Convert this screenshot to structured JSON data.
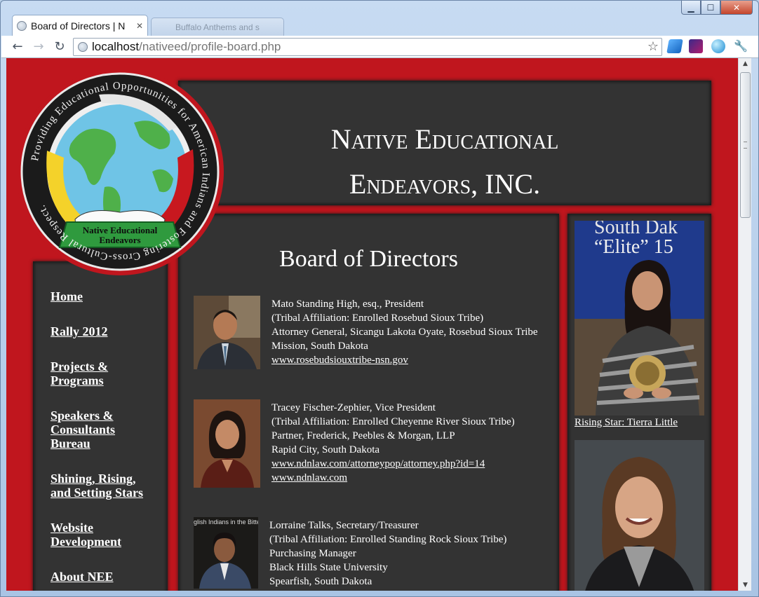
{
  "browser": {
    "active_tab_title": "Board of Directors | N",
    "background_tab_title": "Buffalo Anthems and s",
    "url_host": "localhost",
    "url_path": "/nativeed/profile-board.php",
    "window_controls": [
      "minimize",
      "maximize",
      "close"
    ]
  },
  "logo": {
    "ring_text": "Providing Educational Opportunities for American Indians and Fostering Cross-Cultural Respect.",
    "banner_line1": "Native Educational",
    "banner_line2": "Endeavors"
  },
  "header": {
    "title": "Native Educational Endeavors, INC."
  },
  "nav": {
    "items": [
      {
        "label": "Home"
      },
      {
        "label": "Rally 2012"
      },
      {
        "label": "Projects & Programs"
      },
      {
        "label": "Speakers & Consultants Bureau"
      },
      {
        "label": "Shining, Rising, and Setting Stars"
      },
      {
        "label": "Website Development"
      },
      {
        "label": "About NEE"
      }
    ]
  },
  "main": {
    "heading": "Board of Directors",
    "members": [
      {
        "lines": [
          "Mato Standing High, esq., President",
          "(Tribal Affiliation: Enrolled Rosebud Sioux Tribe)",
          "Attorney General, Sicangu Lakota Oyate, Rosebud Sioux Tribe",
          "Mission, South Dakota"
        ],
        "links": [
          "www.rosebudsiouxtribe-nsn.gov"
        ]
      },
      {
        "lines": [
          "Tracey Fischer-Zephier, Vice President",
          "(Tribal Affiliation: Enrolled Cheyenne River Sioux Tribe)",
          "Partner, Frederick, Peebles & Morgan, LLP",
          "Rapid City, South Dakota"
        ],
        "links": [
          "www.ndnlaw.com/attorneypop/attorney.php?id=14",
          "www.ndnlaw.com"
        ]
      },
      {
        "lines": [
          "Lorraine Talks, Secretary/Treasurer",
          "(Tribal Affiliation: Enrolled Standing Rock Sioux Tribe)",
          "Purchasing Manager",
          "Black Hills State University",
          "Spearfish, South Dakota"
        ],
        "links": []
      }
    ],
    "photo3_sign_text": "glish Indians in the Bitter"
  },
  "sidebar": {
    "banner_line1": "South Dak",
    "banner_line2": "“Elite” 15",
    "caption1": "Rising Star: Tierra Little"
  },
  "colors": {
    "page_red": "#c0161e",
    "panel_dark": "#333333",
    "text_white": "#ffffff"
  }
}
